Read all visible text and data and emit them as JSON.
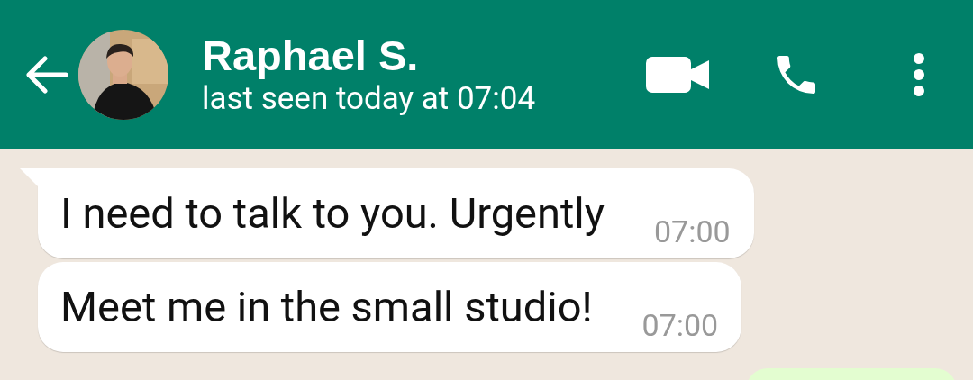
{
  "header": {
    "contact_name": "Raphael S.",
    "status": "last seen today at 07:04"
  },
  "messages": [
    {
      "kind": "incoming",
      "text": "I need to talk to you. Urgently",
      "time": "07:00",
      "tail": true
    },
    {
      "kind": "incoming",
      "text": "Meet me in the small studio!",
      "time": "07:00",
      "tail": false
    },
    {
      "kind": "outgoing"
    }
  ]
}
